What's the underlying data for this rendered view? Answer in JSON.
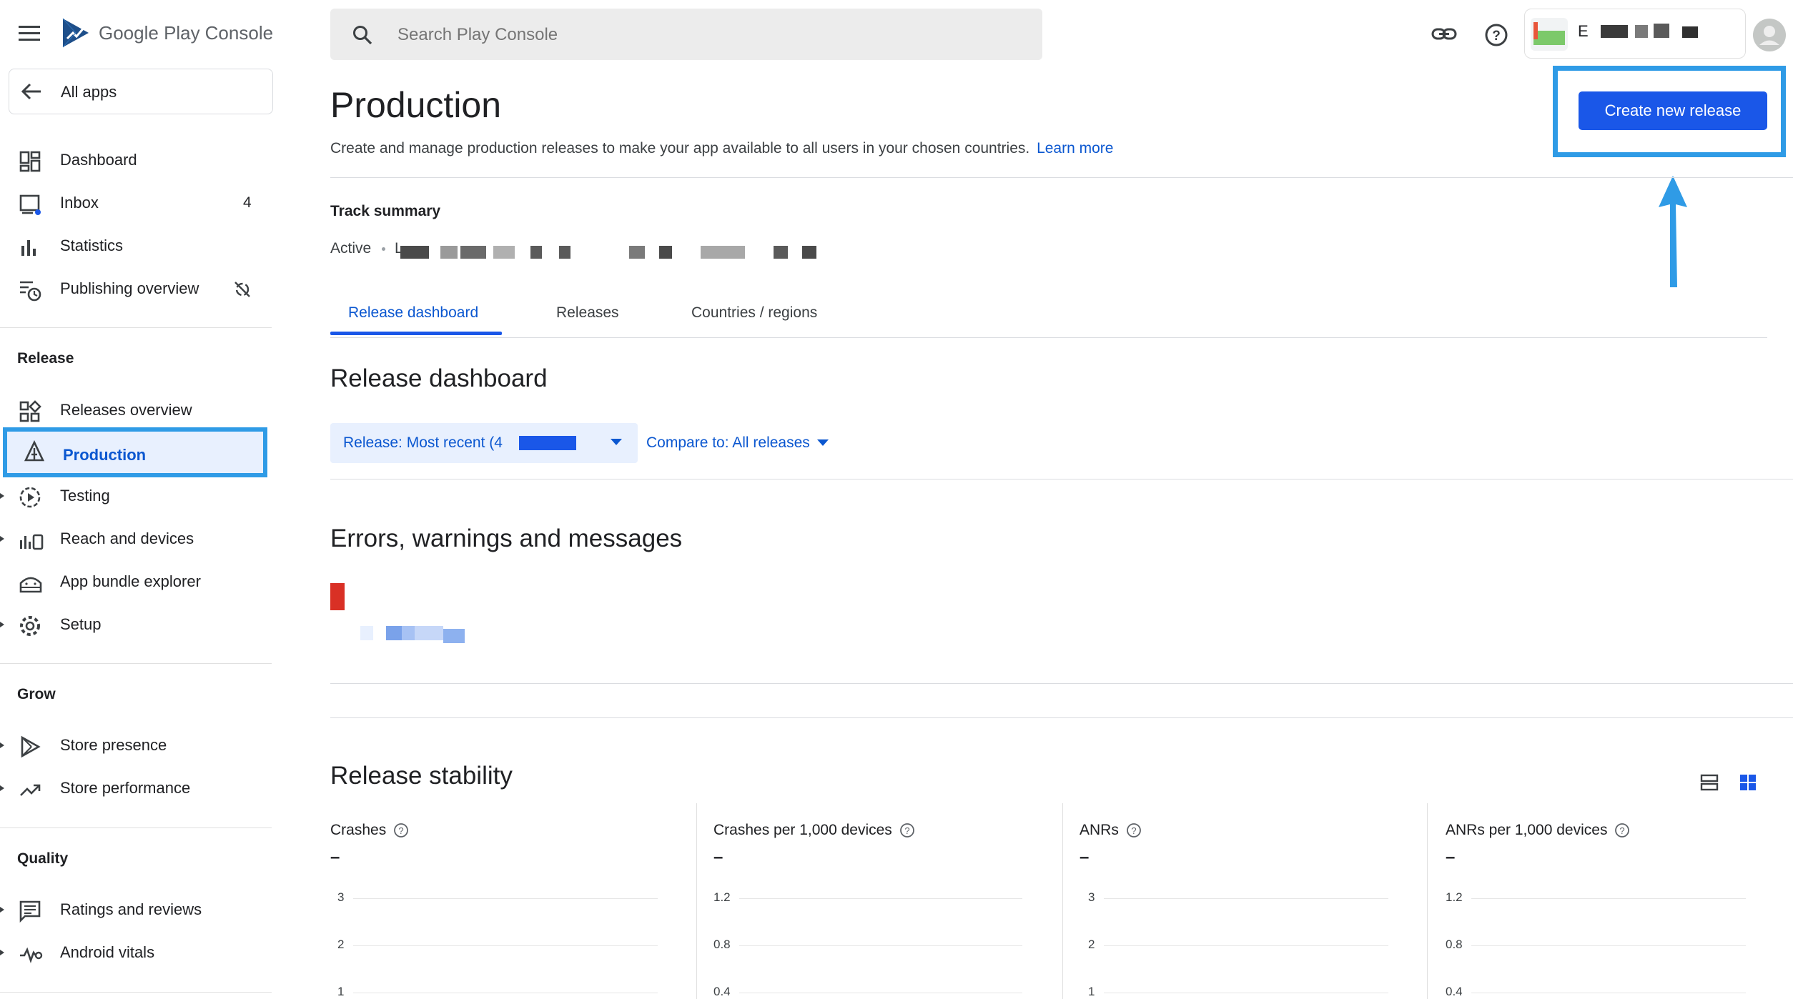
{
  "app": {
    "brand_google": "Google Play",
    "brand_console": "Console"
  },
  "search": {
    "placeholder": "Search Play Console"
  },
  "header": {
    "account_name": "E"
  },
  "nav": {
    "all_apps": "All apps",
    "items": [
      {
        "label": "Dashboard",
        "icon": "dashboard-icon"
      },
      {
        "label": "Inbox",
        "icon": "inbox-icon",
        "count": "4"
      },
      {
        "label": "Statistics",
        "icon": "statistics-icon"
      },
      {
        "label": "Publishing overview",
        "icon": "publishing-icon"
      }
    ],
    "release_section": "Release",
    "release_items": [
      {
        "label": "Releases overview"
      },
      {
        "label": "Production"
      },
      {
        "label": "Testing"
      },
      {
        "label": "Reach and devices"
      },
      {
        "label": "App bundle explorer"
      },
      {
        "label": "Setup"
      }
    ],
    "grow_section": "Grow",
    "grow_items": [
      {
        "label": "Store presence"
      },
      {
        "label": "Store performance"
      }
    ],
    "quality_section": "Quality",
    "quality_items": [
      {
        "label": "Ratings and reviews"
      },
      {
        "label": "Android vitals"
      }
    ]
  },
  "page": {
    "title": "Production",
    "description": "Create and manage production releases to make your app available to all users in your chosen countries.",
    "learn_more": "Learn more",
    "create_button": "Create new release",
    "track_summary_label": "Track summary",
    "track_status": "Active",
    "track_detail_initial": "L",
    "tabs": [
      "Release dashboard",
      "Releases",
      "Countries / regions"
    ],
    "release_dashboard_heading": "Release dashboard",
    "release_filter": "Release: Most recent (4",
    "compare_filter": "Compare to: All releases",
    "errors_heading": "Errors, warnings and messages",
    "stability_heading": "Release stability"
  },
  "stability": {
    "metrics": [
      {
        "title": "Crashes",
        "value": "–",
        "ticks": [
          "3",
          "2",
          "1"
        ]
      },
      {
        "title": "Crashes per 1,000 devices",
        "value": "–",
        "ticks": [
          "1.2",
          "0.8",
          "0.4"
        ]
      },
      {
        "title": "ANRs",
        "value": "–",
        "ticks": [
          "3",
          "2",
          "1"
        ]
      },
      {
        "title": "ANRs per 1,000 devices",
        "value": "–",
        "ticks": [
          "1.2",
          "0.8",
          "0.4"
        ]
      }
    ]
  },
  "colors": {
    "accent": "#1a57e8",
    "link": "#0b57d0",
    "highlight_border": "#2f9be6",
    "error": "#d93025"
  }
}
